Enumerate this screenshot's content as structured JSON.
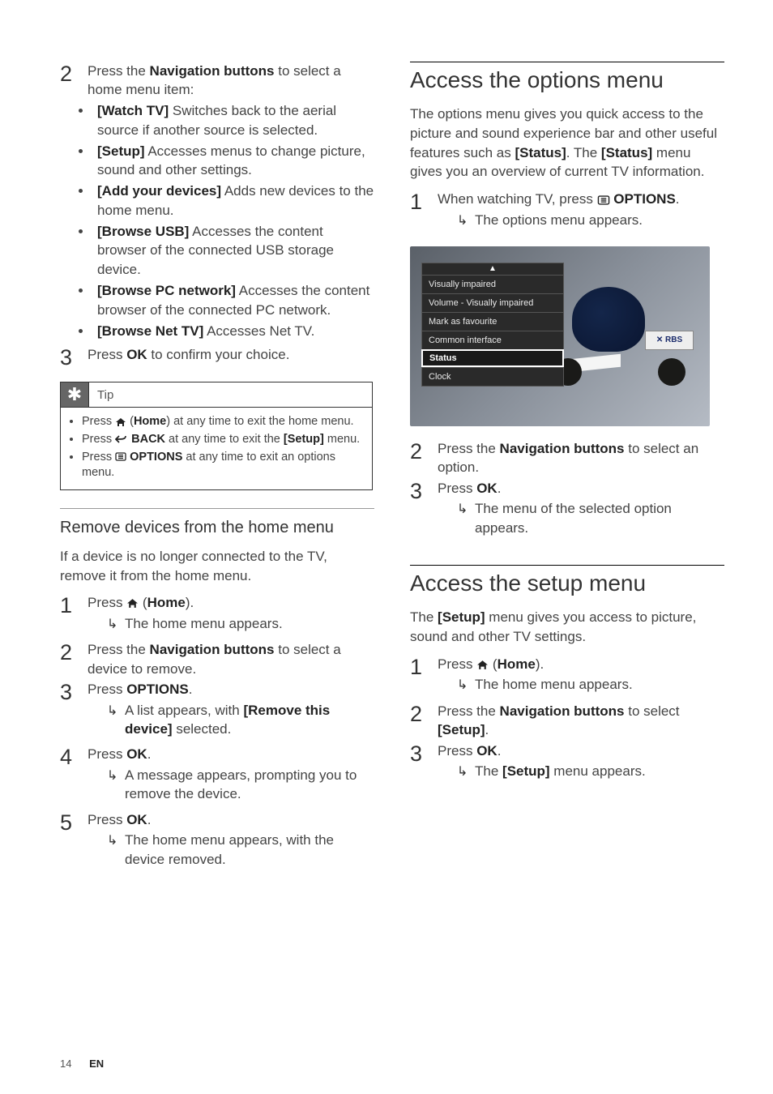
{
  "left": {
    "step2": {
      "pre": "Press the ",
      "bold1": "Navigation buttons",
      "post": " to select a home menu item:"
    },
    "bullets": [
      {
        "bold": "[Watch TV]",
        "text": " Switches back to the aerial source if another source is selected."
      },
      {
        "bold": "[Setup]",
        "text": " Accesses menus to change picture, sound and other settings."
      },
      {
        "bold": "[Add your devices]",
        "text": " Adds new devices to the home menu."
      },
      {
        "bold": "[Browse USB]",
        "text": " Accesses the content browser of the connected USB storage device."
      },
      {
        "bold": "[Browse PC network]",
        "text": " Accesses the content browser of the connected PC network."
      },
      {
        "bold": "[Browse Net TV]",
        "text": " Accesses Net TV."
      }
    ],
    "step3": {
      "pre": "Press ",
      "bold": "OK",
      "post": " to confirm your choice."
    },
    "tip": {
      "title": "Tip",
      "items": [
        {
          "press": "Press ",
          "boldA": "",
          "icon": "home",
          "boldB": "Home",
          "iconParen": true,
          "rest": ") at any time to exit the home menu."
        },
        {
          "press": "Press ",
          "boldA": "",
          "icon": "back",
          "boldB": "BACK",
          "rest": " at any time to exit the ",
          "bold2": "[Setup]",
          "rest2": " menu."
        },
        {
          "press": "Press ",
          "boldA": "",
          "icon": "options",
          "boldB": "OPTIONS",
          "rest": " at any time to exit an options menu."
        }
      ]
    },
    "remove": {
      "heading": "Remove devices from the home menu",
      "intro": "If a device is no longer connected to the TV, remove it from the home menu.",
      "s1": {
        "pre": "Press ",
        "boldB": "Home",
        "post": ")."
      },
      "s1r": "The home menu appears.",
      "s2": {
        "pre": "Press the ",
        "bold": "Navigation buttons",
        "post": " to select a device to remove."
      },
      "s3": {
        "pre": "Press ",
        "bold": "OPTIONS",
        "post": "."
      },
      "s3r": {
        "pre": "A list appears, with ",
        "bold": "[Remove this device]",
        "post": " selected."
      },
      "s4": {
        "pre": "Press ",
        "bold": "OK",
        "post": "."
      },
      "s4r": "A message appears, prompting you to remove the device.",
      "s5": {
        "pre": "Press ",
        "bold": "OK",
        "post": "."
      },
      "s5r": "The home menu appears, with the device removed."
    }
  },
  "right": {
    "options": {
      "heading": "Access the options menu",
      "intro": {
        "t1": "The options menu gives you quick access to the picture and sound experience bar and other useful features such as ",
        "b1": "[Status]",
        "t2": ". The ",
        "b2": "[Status]",
        "t3": " menu gives you an overview of current TV information."
      },
      "s1": {
        "pre": "When watching TV, press ",
        "bold": "OPTIONS",
        "post": "."
      },
      "s1r": "The options menu appears.",
      "menu": [
        "Visually impaired",
        "Volume - Visually impaired",
        "Mark as favourite",
        "Common interface",
        "Status",
        "Clock"
      ],
      "wing": "RBS",
      "s2": {
        "pre": "Press the ",
        "bold": "Navigation buttons",
        "post": " to select an option."
      },
      "s3": {
        "pre": "Press ",
        "bold": "OK",
        "post": "."
      },
      "s3r": "The menu of the selected option appears."
    },
    "setup": {
      "heading": "Access the setup menu",
      "intro": {
        "t1": "The ",
        "b1": "[Setup]",
        "t2": " menu gives you access to picture, sound and other TV settings."
      },
      "s1": {
        "pre": "Press ",
        "boldB": "Home",
        "post": ")."
      },
      "s1r": "The home menu appears.",
      "s2": {
        "pre": "Press the ",
        "bold": "Navigation buttons",
        "post": " to select ",
        "bold2": "[Setup]",
        "post2": "."
      },
      "s3": {
        "pre": "Press ",
        "bold": "OK",
        "post": "."
      },
      "s3r": {
        "t1": "The ",
        "b1": "[Setup]",
        "t2": " menu appears."
      }
    }
  },
  "footer": {
    "page": "14",
    "lang": "EN"
  }
}
